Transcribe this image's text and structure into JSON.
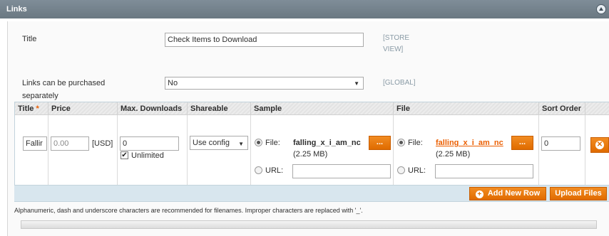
{
  "section": {
    "title": "Links"
  },
  "form": {
    "title_label": "Title",
    "title_value": "Check Items to Download",
    "title_scope_line1": "[STORE",
    "title_scope_line2": "VIEW]",
    "purchase_label_line1": "Links can be purchased",
    "purchase_label_line2": "separately",
    "purchase_value": "No",
    "purchase_scope": "[GLOBAL]"
  },
  "grid": {
    "headers": {
      "title": "Title",
      "required_mark": "*",
      "price": "Price",
      "max_downloads": "Max. Downloads",
      "shareable": "Shareable",
      "sample": "Sample",
      "file": "File",
      "sort_order": "Sort Order"
    },
    "row": {
      "title": "Fallir",
      "price": "0.00",
      "currency": "[USD]",
      "max_downloads": "0",
      "unlimited_label": "Unlimited",
      "unlimited_checked": true,
      "shareable": "Use config",
      "sample_file_label": "File:",
      "sample_file_name": "falling_x_i_am_nc",
      "sample_file_size": "(2.25 MB)",
      "sample_url_label": "URL:",
      "sample_url_value": "",
      "browse_label": "...",
      "file_label": "File:",
      "file_name": "falling_x_i_am_nc",
      "file_size": "(2.25 MB)",
      "file_url_label": "URL:",
      "file_url_value": "",
      "sort_order": "0"
    }
  },
  "buttons": {
    "add_new_row": "Add New Row",
    "upload_files": "Upload Files"
  },
  "note": "Alphanumeric, dash and underscore characters are recommended for filenames. Improper characters are replaced with '_'.",
  "colors": {
    "header_bg": "#75838d",
    "accent": "#eb5e00",
    "footer_bar": "#d8e6ee",
    "scope_text": "#8a9ba6"
  },
  "icons": [
    "collapse-icon",
    "dropdown-arrow-icon",
    "checkmark-icon",
    "delete-icon",
    "add-icon"
  ]
}
